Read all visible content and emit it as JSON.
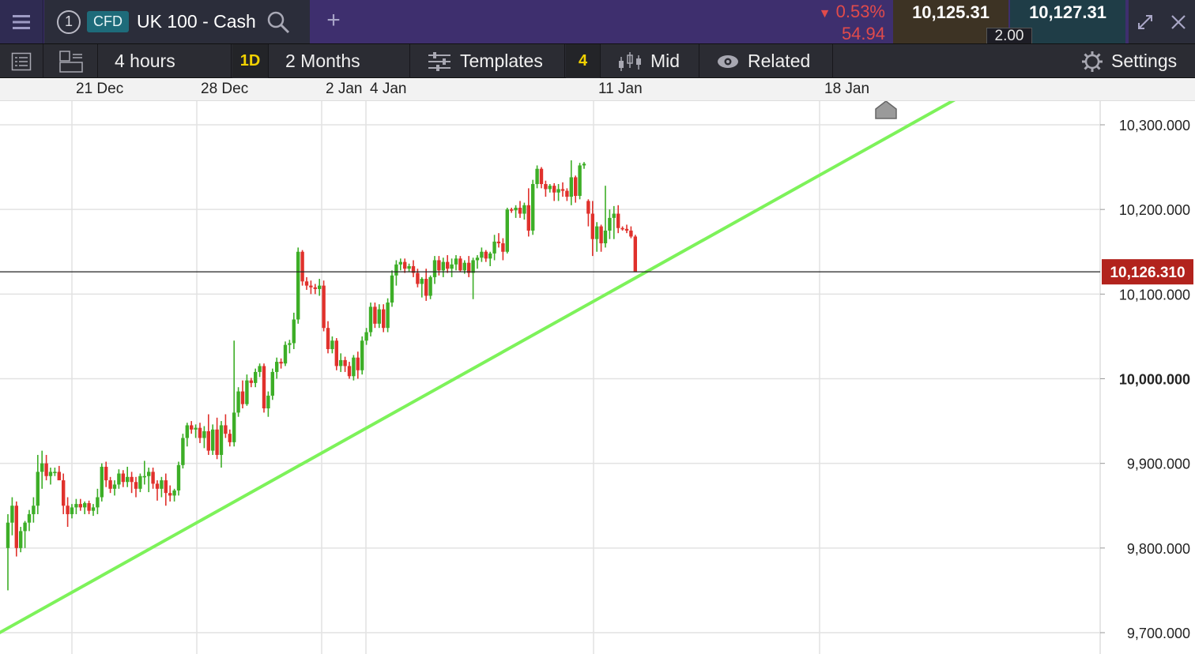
{
  "topbar": {
    "instrument_index": "1",
    "instrument_type": "CFD",
    "instrument_name": "UK 100 - Cash",
    "change_percent": "0.53%",
    "change_value": "54.94",
    "sell_price": "10,125.31",
    "buy_price": "10,127.31",
    "spread": "2.00",
    "icons": {
      "menu": "hamburger-menu-icon",
      "search": "search-icon",
      "add": "plus-icon",
      "expand": "expand-icon",
      "close": "close-icon"
    }
  },
  "toolbar": {
    "interval_label": "4 hours",
    "interval_shortcut": "1D",
    "range_label": "2 Months",
    "templates_label": "Templates",
    "indicator_count": "4",
    "price_type_label": "Mid",
    "related_label": "Related",
    "settings_label": "Settings"
  },
  "colors": {
    "up": "#3dae27",
    "down": "#e0312c",
    "trendline": "#7df25a",
    "current_price_badge": "#b2231d",
    "topbar": "#3e2f6e",
    "toolbar": "#2b2c33"
  },
  "chart_data": {
    "type": "candlestick",
    "x_axis_labels": [
      "21 Dec",
      "28 Dec",
      "2 Jan",
      "4 Jan",
      "11 Jan",
      "18 Jan"
    ],
    "y_axis_labels": [
      "10,300.000",
      "10,200.000",
      "10,100.000",
      "10,000.000",
      "9,900.000",
      "9,800.000",
      "9,700.000"
    ],
    "y_ticks": [
      10300,
      10200,
      10100,
      10000,
      9900,
      9800,
      9700
    ],
    "ylim": [
      9690,
      10330
    ],
    "current_price": 10126.31,
    "current_price_label": "10,126.310",
    "grid": true,
    "trendline": {
      "from": {
        "candle": -3,
        "price": 9697
      },
      "to": {
        "candle": 222,
        "price": 10330
      }
    },
    "candles": [
      [
        9800,
        9840,
        9750,
        9830
      ],
      [
        9830,
        9860,
        9815,
        9850
      ],
      [
        9850,
        9855,
        9790,
        9800
      ],
      [
        9800,
        9825,
        9795,
        9820
      ],
      [
        9820,
        9832,
        9800,
        9830
      ],
      [
        9830,
        9845,
        9820,
        9840
      ],
      [
        9840,
        9860,
        9830,
        9850
      ],
      [
        9850,
        9910,
        9840,
        9890
      ],
      [
        9890,
        9915,
        9870,
        9900
      ],
      [
        9900,
        9910,
        9880,
        9885
      ],
      [
        9885,
        9895,
        9875,
        9890
      ],
      [
        9890,
        9895,
        9885,
        9890
      ],
      [
        9890,
        9897,
        9885,
        9880
      ],
      [
        9880,
        9888,
        9840,
        9850
      ],
      [
        9850,
        9860,
        9825,
        9840
      ],
      [
        9840,
        9852,
        9835,
        9848
      ],
      [
        9848,
        9858,
        9840,
        9852
      ],
      [
        9852,
        9858,
        9844,
        9848
      ],
      [
        9848,
        9855,
        9840,
        9853
      ],
      [
        9853,
        9856,
        9840,
        9844
      ],
      [
        9844,
        9852,
        9838,
        9848
      ],
      [
        9848,
        9870,
        9840,
        9860
      ],
      [
        9860,
        9900,
        9855,
        9896
      ],
      [
        9896,
        9902,
        9872,
        9880
      ],
      [
        9880,
        9884,
        9865,
        9870
      ],
      [
        9870,
        9880,
        9862,
        9875
      ],
      [
        9875,
        9893,
        9870,
        9888
      ],
      [
        9888,
        9892,
        9872,
        9878
      ],
      [
        9878,
        9896,
        9872,
        9884
      ],
      [
        9884,
        9890,
        9865,
        9878
      ],
      [
        9878,
        9884,
        9860,
        9870
      ],
      [
        9870,
        9888,
        9866,
        9885
      ],
      [
        9885,
        9903,
        9875,
        9885
      ],
      [
        9885,
        9895,
        9866,
        9890
      ],
      [
        9890,
        9895,
        9870,
        9876
      ],
      [
        9876,
        9880,
        9856,
        9870
      ],
      [
        9870,
        9884,
        9860,
        9880
      ],
      [
        9880,
        9888,
        9850,
        9865
      ],
      [
        9865,
        9874,
        9855,
        9862
      ],
      [
        9862,
        9870,
        9855,
        9868
      ],
      [
        9868,
        9902,
        9862,
        9898
      ],
      [
        9898,
        9935,
        9894,
        9930
      ],
      [
        9930,
        9948,
        9920,
        9945
      ],
      [
        9945,
        9950,
        9935,
        9940
      ],
      [
        9940,
        9946,
        9930,
        9942
      ],
      [
        9942,
        9948,
        9924,
        9930
      ],
      [
        9930,
        9944,
        9918,
        9938
      ],
      [
        9938,
        9958,
        9910,
        9915
      ],
      [
        9915,
        9946,
        9910,
        9940
      ],
      [
        9940,
        9954,
        9905,
        9910
      ],
      [
        9910,
        9950,
        9895,
        9945
      ],
      [
        9945,
        9958,
        9930,
        9935
      ],
      [
        9935,
        9940,
        9920,
        9925
      ],
      [
        9925,
        10045,
        9920,
        9960
      ],
      [
        9960,
        9990,
        9955,
        9985
      ],
      [
        9985,
        9998,
        9965,
        9970
      ],
      [
        9970,
        10005,
        9968,
        9998
      ],
      [
        9998,
        10001,
        9990,
        9995
      ],
      [
        9995,
        10012,
        9990,
        10008
      ],
      [
        10008,
        10018,
        10002,
        10015
      ],
      [
        10015,
        10018,
        9960,
        9965
      ],
      [
        9965,
        9985,
        9955,
        9980
      ],
      [
        9980,
        10012,
        9975,
        10008
      ],
      [
        10008,
        10025,
        10000,
        10020
      ],
      [
        10020,
        10024,
        10012,
        10018
      ],
      [
        10018,
        10044,
        10015,
        10040
      ],
      [
        10040,
        10046,
        10030,
        10042
      ],
      [
        10042,
        10078,
        10035,
        10070
      ],
      [
        10070,
        10155,
        10065,
        10150
      ],
      [
        10150,
        10152,
        10110,
        10115
      ],
      [
        10115,
        10120,
        10105,
        10110
      ],
      [
        10110,
        10116,
        10100,
        10108
      ],
      [
        10108,
        10112,
        10100,
        10106
      ],
      [
        10106,
        10118,
        10098,
        10110
      ],
      [
        10110,
        10116,
        10056,
        10060
      ],
      [
        10060,
        10068,
        10030,
        10035
      ],
      [
        10035,
        10050,
        10030,
        10045
      ],
      [
        10045,
        10048,
        10010,
        10015
      ],
      [
        10015,
        10030,
        10008,
        10022
      ],
      [
        10022,
        10026,
        10008,
        10015
      ],
      [
        10015,
        10020,
        10000,
        10003
      ],
      [
        10003,
        10028,
        9998,
        10025
      ],
      [
        10025,
        10032,
        10000,
        10010
      ],
      [
        10010,
        10050,
        10005,
        10045
      ],
      [
        10045,
        10060,
        10040,
        10055
      ],
      [
        10055,
        10090,
        10050,
        10085
      ],
      [
        10085,
        10090,
        10060,
        10065
      ],
      [
        10065,
        10088,
        10060,
        10082
      ],
      [
        10082,
        10088,
        10055,
        10060
      ],
      [
        10060,
        10095,
        10055,
        10090
      ],
      [
        10090,
        10128,
        10085,
        10122
      ],
      [
        10122,
        10140,
        10110,
        10135
      ],
      [
        10135,
        10142,
        10128,
        10138
      ],
      [
        10138,
        10142,
        10125,
        10130
      ],
      [
        10130,
        10136,
        10126,
        10133
      ],
      [
        10133,
        10140,
        10120,
        10125
      ],
      [
        10125,
        10130,
        10108,
        10112
      ],
      [
        10112,
        10120,
        10096,
        10118
      ],
      [
        10118,
        10130,
        10092,
        10098
      ],
      [
        10098,
        10122,
        10094,
        10120
      ],
      [
        10120,
        10145,
        10112,
        10140
      ],
      [
        10140,
        10145,
        10122,
        10128
      ],
      [
        10128,
        10143,
        10120,
        10138
      ],
      [
        10138,
        10146,
        10125,
        10130
      ],
      [
        10130,
        10142,
        10120,
        10135
      ],
      [
        10135,
        10146,
        10128,
        10142
      ],
      [
        10142,
        10145,
        10126,
        10128
      ],
      [
        10128,
        10140,
        10124,
        10137
      ],
      [
        10137,
        10145,
        10120,
        10125
      ],
      [
        10125,
        10143,
        10094,
        10140
      ],
      [
        10140,
        10146,
        10130,
        10143
      ],
      [
        10143,
        10155,
        10138,
        10150
      ],
      [
        10150,
        10152,
        10138,
        10142
      ],
      [
        10142,
        10150,
        10133,
        10148
      ],
      [
        10148,
        10170,
        10140,
        10162
      ],
      [
        10162,
        10172,
        10155,
        10160
      ],
      [
        10160,
        10166,
        10140,
        10150
      ],
      [
        10150,
        10202,
        10148,
        10200
      ],
      [
        10200,
        10202,
        10196,
        10199
      ],
      [
        10199,
        10205,
        10190,
        10202
      ],
      [
        10202,
        10210,
        10190,
        10195
      ],
      [
        10195,
        10208,
        10188,
        10205
      ],
      [
        10205,
        10225,
        10168,
        10175
      ],
      [
        10175,
        10235,
        10170,
        10230
      ],
      [
        10230,
        10252,
        10225,
        10248
      ],
      [
        10248,
        10250,
        10225,
        10230
      ],
      [
        10230,
        10234,
        10215,
        10224
      ],
      [
        10224,
        10230,
        10220,
        10228
      ],
      [
        10228,
        10231,
        10210,
        10220
      ],
      [
        10220,
        10230,
        10210,
        10224
      ],
      [
        10224,
        10232,
        10215,
        10222
      ],
      [
        10222,
        10225,
        10210,
        10215
      ],
      [
        10215,
        10258,
        10205,
        10238
      ],
      [
        10238,
        10240,
        10208,
        10216
      ],
      [
        10216,
        10255,
        10212,
        10252
      ],
      [
        10252,
        10256,
        10248,
        10254
      ],
      [
        10210,
        10212,
        10180,
        10195
      ],
      [
        10195,
        10210,
        10145,
        10165
      ],
      [
        10165,
        10185,
        10150,
        10180
      ],
      [
        10180,
        10182,
        10150,
        10160
      ],
      [
        10160,
        10228,
        10155,
        10175
      ],
      [
        10175,
        10200,
        10165,
        10190
      ],
      [
        10190,
        10204,
        10165,
        10195
      ],
      [
        10195,
        10205,
        10172,
        10178
      ],
      [
        10178,
        10180,
        10175,
        10177
      ],
      [
        10177,
        10182,
        10172,
        10175
      ],
      [
        10175,
        10180,
        10166,
        10168
      ],
      [
        10168,
        10170,
        10126,
        10126
      ]
    ]
  }
}
